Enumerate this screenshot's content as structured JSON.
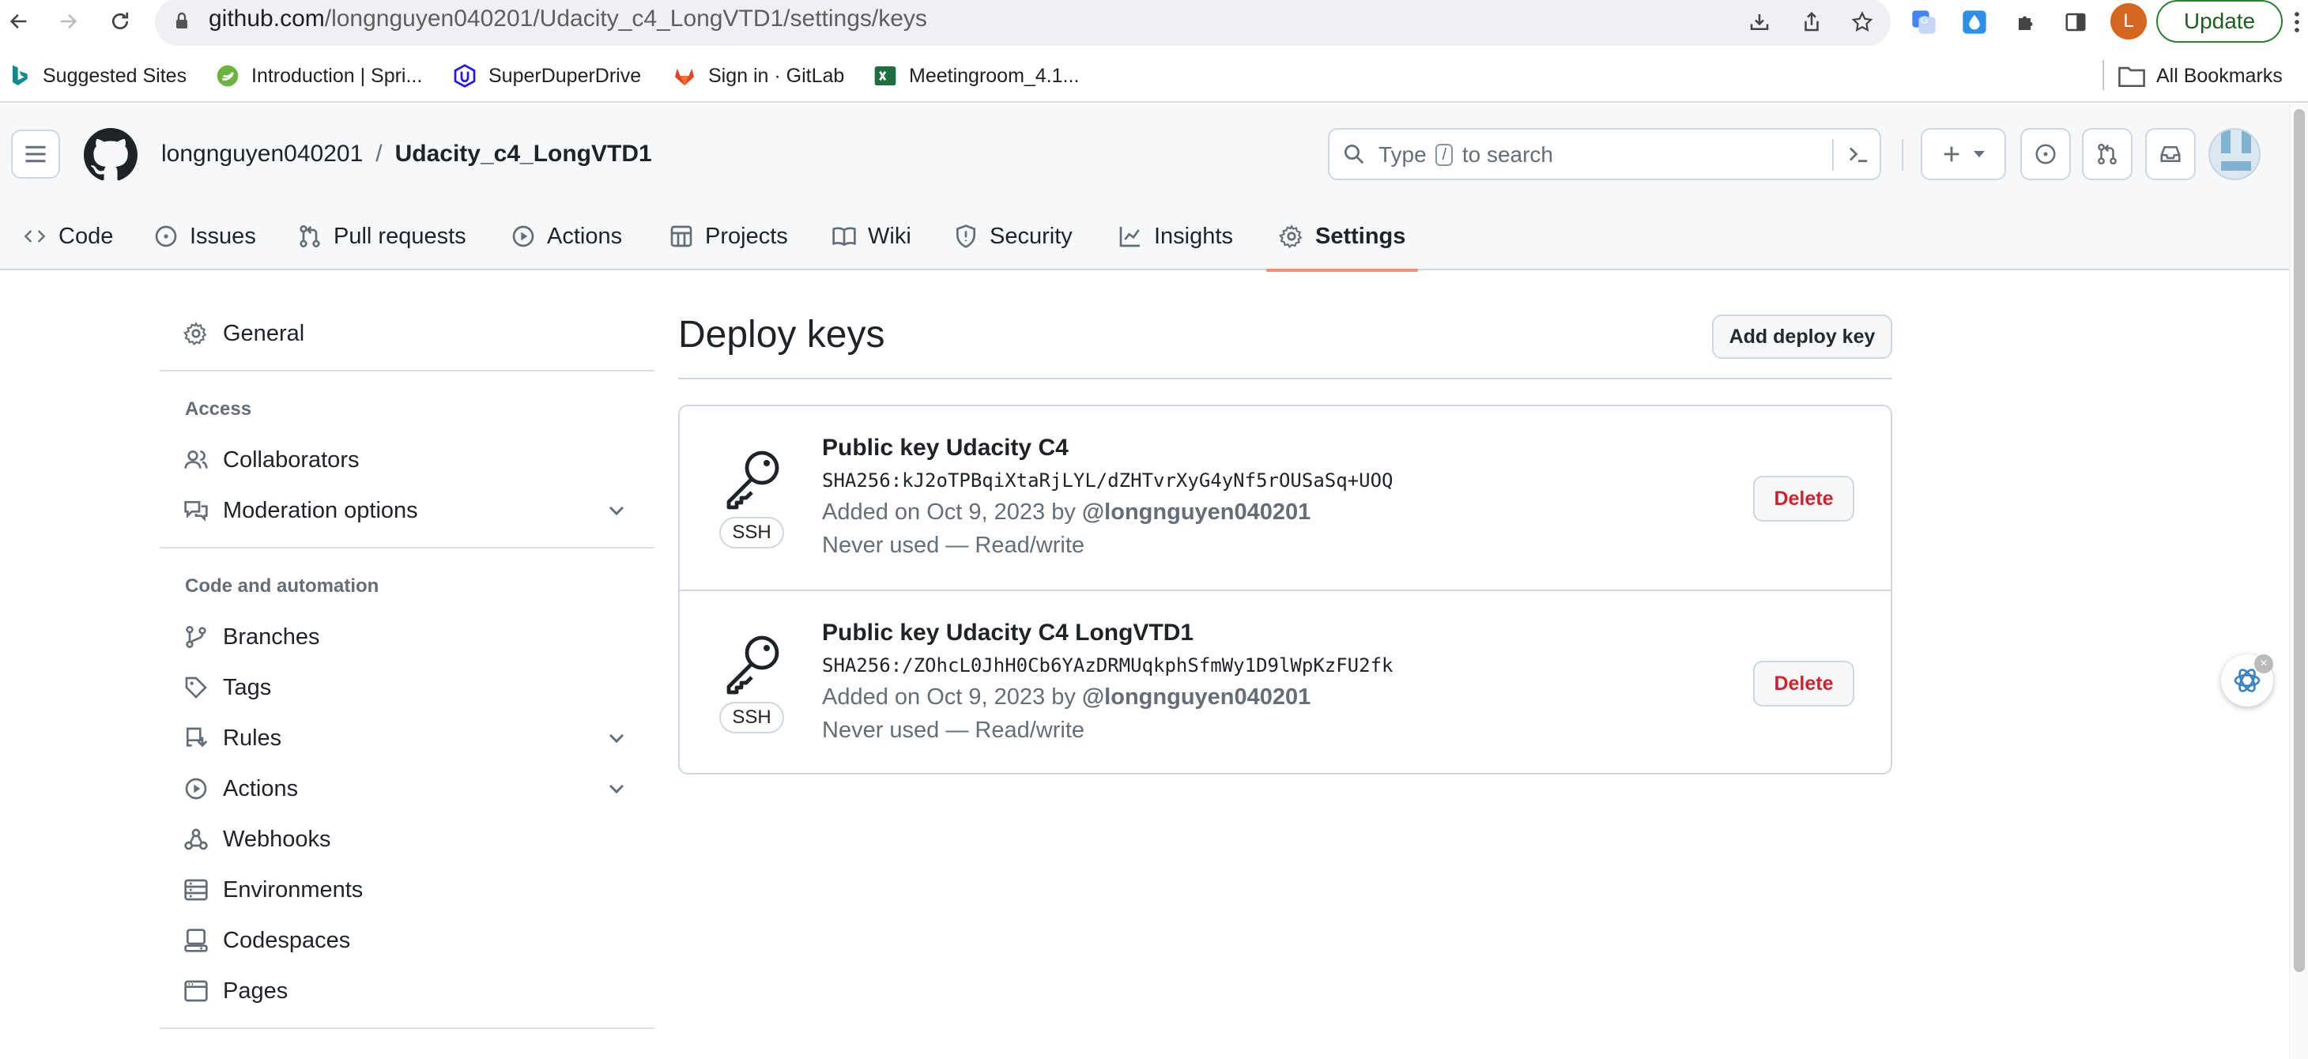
{
  "browser": {
    "url_host": "github.com",
    "url_path": "/longnguyen040201/Udacity_c4_LongVTD1/settings/keys",
    "profile_initial": "L",
    "update_label": "Update",
    "bookmarks": [
      {
        "label": "Suggested Sites",
        "icon": "bing-icon"
      },
      {
        "label": "Introduction | Spri...",
        "icon": "spring-icon"
      },
      {
        "label": "SuperDuperDrive",
        "icon": "udacity-icon"
      },
      {
        "label": "Sign in · GitLab",
        "icon": "gitlab-icon"
      },
      {
        "label": "Meetingroom_4.1...",
        "icon": "excel-icon"
      }
    ],
    "all_bookmarks_label": "All Bookmarks"
  },
  "header": {
    "owner": "longnguyen040201",
    "separator": "/",
    "repo": "Udacity_c4_LongVTD1",
    "search_prefix": "Type",
    "search_key": "/",
    "search_suffix": "to search"
  },
  "tabs": [
    {
      "label": "Code",
      "icon": "code-icon"
    },
    {
      "label": "Issues",
      "icon": "issue-icon"
    },
    {
      "label": "Pull requests",
      "icon": "pull-request-icon"
    },
    {
      "label": "Actions",
      "icon": "play-icon"
    },
    {
      "label": "Projects",
      "icon": "table-icon"
    },
    {
      "label": "Wiki",
      "icon": "book-icon"
    },
    {
      "label": "Security",
      "icon": "shield-icon"
    },
    {
      "label": "Insights",
      "icon": "graph-icon"
    },
    {
      "label": "Settings",
      "icon": "gear-icon",
      "active": true
    }
  ],
  "sidebar": {
    "general": "General",
    "access_heading": "Access",
    "collaborators": "Collaborators",
    "moderation": "Moderation options",
    "code_heading": "Code and automation",
    "branches": "Branches",
    "tags": "Tags",
    "rules": "Rules",
    "actions": "Actions",
    "webhooks": "Webhooks",
    "environments": "Environments",
    "codespaces": "Codespaces",
    "pages": "Pages"
  },
  "main": {
    "title": "Deploy keys",
    "add_button": "Add deploy key",
    "keys": [
      {
        "title": "Public key Udacity C4",
        "fingerprint": "SHA256:kJ2oTPBqiXtaRjLYL/dZHTvrXyG4yNf5rOUSaSq+UOQ",
        "badge": "SSH",
        "added": "Added on Oct 9, 2023 by",
        "by_user": "@longnguyen040201",
        "usage": "Never used — Read/write",
        "delete_label": "Delete"
      },
      {
        "title": "Public key Udacity C4 LongVTD1",
        "fingerprint": "SHA256:/ZOhcL0JhH0Cb6YAzDRMUqkphSfmWy1D9lWpKzFU2fk",
        "badge": "SSH",
        "added": "Added on Oct 9, 2023 by",
        "by_user": "@longnguyen040201",
        "usage": "Never used — Read/write",
        "delete_label": "Delete"
      }
    ]
  },
  "colors": {
    "active_tab_underline": "#fd8c73",
    "danger": "#cf222e",
    "update_border": "#2e7d32"
  }
}
